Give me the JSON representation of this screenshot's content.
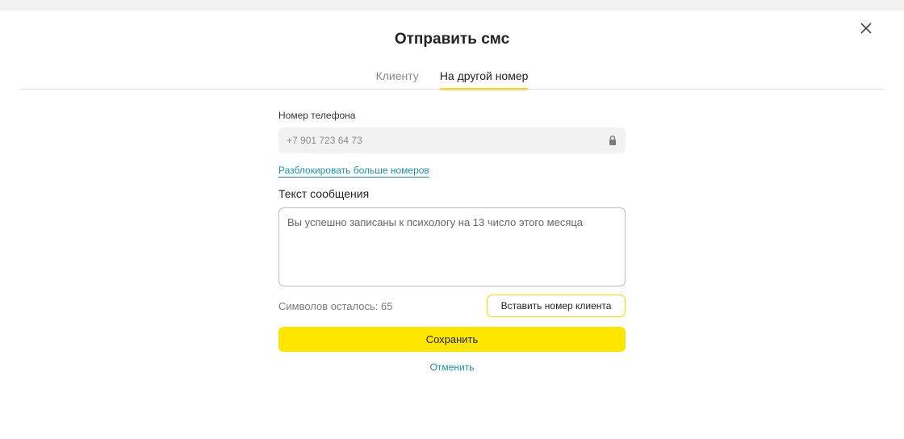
{
  "dialog": {
    "title": "Отправить смс",
    "tabs": [
      {
        "label": "Клиенту",
        "active": false
      },
      {
        "label": "На другой номер",
        "active": true
      }
    ]
  },
  "form": {
    "phone_label": "Номер телефона",
    "phone_value": "+7 901 723 64 73",
    "unlock_link": "Разблокировать больше номеров",
    "message_label": "Текст сообщения",
    "message_value": "Вы успешно записаны к психологу на 13 число этого месяца",
    "chars_remaining": "Символов  осталось: 65",
    "insert_client_number": "Вставить номер клиента",
    "save_label": "Сохранить",
    "cancel_label": "Отменить"
  },
  "colors": {
    "accent": "#ffe600",
    "link": "#1e8fa8"
  },
  "icons": {
    "close": "close-icon",
    "lock": "lock-icon"
  }
}
